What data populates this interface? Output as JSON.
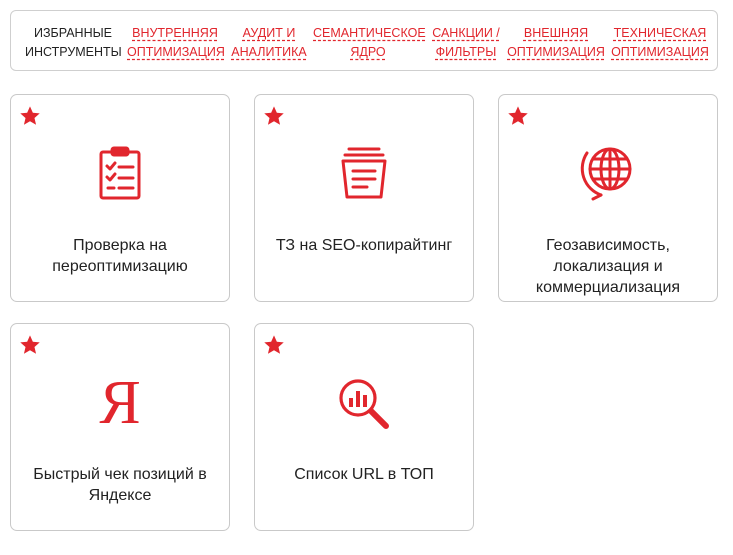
{
  "nav": {
    "label": [
      "ИЗБРАННЫЕ",
      "ИНСТРУМЕНТЫ"
    ],
    "links": [
      [
        "ВНУТРЕННЯЯ",
        "ОПТИМИЗАЦИЯ"
      ],
      [
        "АУДИТ И",
        "АНАЛИТИКА"
      ],
      [
        "СЕМАНТИЧЕСКОЕ",
        "ЯДРО"
      ],
      [
        "САНКЦИИ /",
        "ФИЛЬТРЫ"
      ],
      [
        "ВНЕШНЯЯ",
        "ОПТИМИЗАЦИЯ"
      ],
      [
        "ТЕХНИЧЕСКАЯ",
        "ОПТИМИЗАЦИЯ"
      ]
    ]
  },
  "cards": [
    {
      "title": [
        "Проверка на",
        "переоптимизацию"
      ],
      "icon": "clipboard-checklist-icon",
      "favorite": true
    },
    {
      "title": [
        "ТЗ на SEO-копирайтинг"
      ],
      "icon": "document-stack-icon",
      "favorite": true
    },
    {
      "title": [
        "Геозависимость,",
        "локализация и",
        "коммерциализация"
      ],
      "icon": "globe-icon",
      "favorite": true
    },
    {
      "title": [
        "Быстрый чек позиций в",
        "Яндексе"
      ],
      "icon": "yandex-icon",
      "icon_text": "Я",
      "favorite": true
    },
    {
      "title": [
        "Список URL в ТОП"
      ],
      "icon": "magnifier-chart-icon",
      "favorite": true
    }
  ],
  "colors": {
    "accent": "#e1262d",
    "border": "#c9c9c9",
    "text": "#222222"
  }
}
